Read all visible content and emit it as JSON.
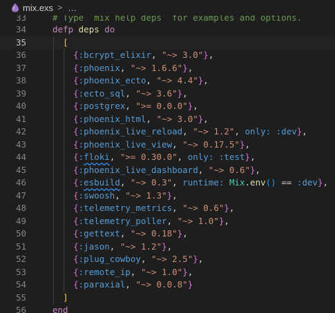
{
  "breadcrumb": {
    "file": "mix.exs",
    "separator": ">",
    "more": "…"
  },
  "editor": {
    "active_line": "35",
    "lines": [
      {
        "n": "33",
        "partial": true,
        "indent": 0,
        "tokens": [
          {
            "t": "# Type `mix help deps` for examples and options.",
            "c": "comment"
          }
        ]
      },
      {
        "n": "34",
        "indent": 0,
        "tokens": [
          {
            "t": "defp ",
            "c": "kw"
          },
          {
            "t": "deps",
            "c": "fn"
          },
          {
            "t": " do",
            "c": "kw"
          }
        ]
      },
      {
        "n": "35",
        "indent": 1,
        "tokens": [
          {
            "t": "[",
            "c": "bracket"
          }
        ]
      },
      {
        "n": "36",
        "indent": 2,
        "tokens": [
          {
            "t": "{",
            "c": "brace"
          },
          {
            "t": ":bcrypt_elixir",
            "c": "atom"
          },
          {
            "t": ", ",
            "c": "plain"
          },
          {
            "t": "\"~> 3.0\"",
            "c": "str"
          },
          {
            "t": "}",
            "c": "brace"
          },
          {
            "t": ",",
            "c": "plain"
          }
        ]
      },
      {
        "n": "37",
        "indent": 2,
        "tokens": [
          {
            "t": "{",
            "c": "brace"
          },
          {
            "t": ":phoenix",
            "c": "atom"
          },
          {
            "t": ", ",
            "c": "plain"
          },
          {
            "t": "\"~> 1.6.6\"",
            "c": "str"
          },
          {
            "t": "}",
            "c": "brace"
          },
          {
            "t": ",",
            "c": "plain"
          }
        ]
      },
      {
        "n": "38",
        "indent": 2,
        "tokens": [
          {
            "t": "{",
            "c": "brace"
          },
          {
            "t": ":phoenix_ecto",
            "c": "atom"
          },
          {
            "t": ", ",
            "c": "plain"
          },
          {
            "t": "\"~> 4.4\"",
            "c": "str"
          },
          {
            "t": "}",
            "c": "brace"
          },
          {
            "t": ",",
            "c": "plain"
          }
        ]
      },
      {
        "n": "39",
        "indent": 2,
        "tokens": [
          {
            "t": "{",
            "c": "brace"
          },
          {
            "t": ":ecto_sql",
            "c": "atom"
          },
          {
            "t": ", ",
            "c": "plain"
          },
          {
            "t": "\"~> 3.6\"",
            "c": "str"
          },
          {
            "t": "}",
            "c": "brace"
          },
          {
            "t": ",",
            "c": "plain"
          }
        ]
      },
      {
        "n": "40",
        "indent": 2,
        "tokens": [
          {
            "t": "{",
            "c": "brace"
          },
          {
            "t": ":postgrex",
            "c": "atom"
          },
          {
            "t": ", ",
            "c": "plain"
          },
          {
            "t": "\">= 0.0.0\"",
            "c": "str"
          },
          {
            "t": "}",
            "c": "brace"
          },
          {
            "t": ",",
            "c": "plain"
          }
        ]
      },
      {
        "n": "41",
        "indent": 2,
        "tokens": [
          {
            "t": "{",
            "c": "brace"
          },
          {
            "t": ":phoenix_html",
            "c": "atom"
          },
          {
            "t": ", ",
            "c": "plain"
          },
          {
            "t": "\"~> 3.0\"",
            "c": "str"
          },
          {
            "t": "}",
            "c": "brace"
          },
          {
            "t": ",",
            "c": "plain"
          }
        ]
      },
      {
        "n": "42",
        "indent": 2,
        "tokens": [
          {
            "t": "{",
            "c": "brace"
          },
          {
            "t": ":phoenix_live_reload",
            "c": "atom"
          },
          {
            "t": ", ",
            "c": "plain"
          },
          {
            "t": "\"~> 1.2\"",
            "c": "str"
          },
          {
            "t": ", ",
            "c": "plain"
          },
          {
            "t": "only: :dev",
            "c": "atom"
          },
          {
            "t": "}",
            "c": "brace"
          },
          {
            "t": ",",
            "c": "plain"
          }
        ]
      },
      {
        "n": "43",
        "indent": 2,
        "tokens": [
          {
            "t": "{",
            "c": "brace"
          },
          {
            "t": ":phoenix_live_view",
            "c": "atom"
          },
          {
            "t": ", ",
            "c": "plain"
          },
          {
            "t": "\"~> 0.17.5\"",
            "c": "str"
          },
          {
            "t": "}",
            "c": "brace"
          },
          {
            "t": ",",
            "c": "plain"
          }
        ]
      },
      {
        "n": "44",
        "indent": 2,
        "tokens": [
          {
            "t": "{",
            "c": "brace"
          },
          {
            "t": ":",
            "c": "atom"
          },
          {
            "t": "floki",
            "c": "atom",
            "sq": true
          },
          {
            "t": ", ",
            "c": "plain"
          },
          {
            "t": "\">= 0.30.0\"",
            "c": "str"
          },
          {
            "t": ", ",
            "c": "plain"
          },
          {
            "t": "only: :test",
            "c": "atom"
          },
          {
            "t": "}",
            "c": "brace"
          },
          {
            "t": ",",
            "c": "plain"
          }
        ]
      },
      {
        "n": "45",
        "indent": 2,
        "tokens": [
          {
            "t": "{",
            "c": "brace"
          },
          {
            "t": ":phoenix_live_dashboard",
            "c": "atom"
          },
          {
            "t": ", ",
            "c": "plain"
          },
          {
            "t": "\"~> 0.6\"",
            "c": "str"
          },
          {
            "t": "}",
            "c": "brace"
          },
          {
            "t": ",",
            "c": "plain"
          }
        ]
      },
      {
        "n": "46",
        "indent": 2,
        "tokens": [
          {
            "t": "{",
            "c": "brace"
          },
          {
            "t": ":",
            "c": "atom"
          },
          {
            "t": "esbuild",
            "c": "atom",
            "sq": true
          },
          {
            "t": ", ",
            "c": "plain"
          },
          {
            "t": "\"~> 0.3\"",
            "c": "str"
          },
          {
            "t": ", ",
            "c": "plain"
          },
          {
            "t": "runtime: ",
            "c": "atom"
          },
          {
            "t": "Mix",
            "c": "mod"
          },
          {
            "t": ".",
            "c": "plain"
          },
          {
            "t": "env",
            "c": "fn"
          },
          {
            "t": "()",
            "c": "paren"
          },
          {
            "t": " == ",
            "c": "plain"
          },
          {
            "t": ":dev",
            "c": "atom"
          },
          {
            "t": "}",
            "c": "brace"
          },
          {
            "t": ",",
            "c": "plain"
          }
        ]
      },
      {
        "n": "47",
        "indent": 2,
        "tokens": [
          {
            "t": "{",
            "c": "brace"
          },
          {
            "t": ":swoosh",
            "c": "atom"
          },
          {
            "t": ", ",
            "c": "plain"
          },
          {
            "t": "\"~> 1.3\"",
            "c": "str"
          },
          {
            "t": "}",
            "c": "brace"
          },
          {
            "t": ",",
            "c": "plain"
          }
        ]
      },
      {
        "n": "48",
        "indent": 2,
        "tokens": [
          {
            "t": "{",
            "c": "brace"
          },
          {
            "t": ":telemetry_metrics",
            "c": "atom"
          },
          {
            "t": ", ",
            "c": "plain"
          },
          {
            "t": "\"~> 0.6\"",
            "c": "str"
          },
          {
            "t": "}",
            "c": "brace"
          },
          {
            "t": ",",
            "c": "plain"
          }
        ]
      },
      {
        "n": "49",
        "indent": 2,
        "tokens": [
          {
            "t": "{",
            "c": "brace"
          },
          {
            "t": ":telemetry_poller",
            "c": "atom"
          },
          {
            "t": ", ",
            "c": "plain"
          },
          {
            "t": "\"~> 1.0\"",
            "c": "str"
          },
          {
            "t": "}",
            "c": "brace"
          },
          {
            "t": ",",
            "c": "plain"
          }
        ]
      },
      {
        "n": "50",
        "indent": 2,
        "tokens": [
          {
            "t": "{",
            "c": "brace"
          },
          {
            "t": ":gettext",
            "c": "atom"
          },
          {
            "t": ", ",
            "c": "plain"
          },
          {
            "t": "\"~> 0.18\"",
            "c": "str"
          },
          {
            "t": "}",
            "c": "brace"
          },
          {
            "t": ",",
            "c": "plain"
          }
        ]
      },
      {
        "n": "51",
        "indent": 2,
        "tokens": [
          {
            "t": "{",
            "c": "brace"
          },
          {
            "t": ":jason",
            "c": "atom"
          },
          {
            "t": ", ",
            "c": "plain"
          },
          {
            "t": "\"~> 1.2\"",
            "c": "str"
          },
          {
            "t": "}",
            "c": "brace"
          },
          {
            "t": ",",
            "c": "plain"
          }
        ]
      },
      {
        "n": "52",
        "indent": 2,
        "tokens": [
          {
            "t": "{",
            "c": "brace"
          },
          {
            "t": ":plug_cowboy",
            "c": "atom"
          },
          {
            "t": ", ",
            "c": "plain"
          },
          {
            "t": "\"~> 2.5\"",
            "c": "str"
          },
          {
            "t": "}",
            "c": "brace"
          },
          {
            "t": ",",
            "c": "plain"
          }
        ]
      },
      {
        "n": "53",
        "indent": 2,
        "tokens": [
          {
            "t": "{",
            "c": "brace"
          },
          {
            "t": ":remote_ip",
            "c": "atom"
          },
          {
            "t": ", ",
            "c": "plain"
          },
          {
            "t": "\"~> 1.0\"",
            "c": "str"
          },
          {
            "t": "}",
            "c": "brace"
          },
          {
            "t": ",",
            "c": "plain"
          }
        ]
      },
      {
        "n": "54",
        "indent": 2,
        "tokens": [
          {
            "t": "{",
            "c": "brace"
          },
          {
            "t": ":paraxial",
            "c": "atom"
          },
          {
            "t": ", ",
            "c": "plain"
          },
          {
            "t": "\"~> 0.0.8\"",
            "c": "str"
          },
          {
            "t": "}",
            "c": "brace"
          }
        ]
      },
      {
        "n": "55",
        "indent": 1,
        "tokens": [
          {
            "t": "]",
            "c": "bracket"
          }
        ]
      },
      {
        "n": "56",
        "indent": 0,
        "tokens": [
          {
            "t": "end",
            "c": "kw"
          }
        ]
      }
    ]
  },
  "colors": {
    "background": "#1e1e1e",
    "keyword": "#c586c0",
    "function": "#dcdcaa",
    "atom": "#569cd6",
    "string": "#ce9178",
    "brace": "#da70d6",
    "bracket": "#ffd700",
    "module": "#4ec9b0"
  },
  "icons": {
    "file": "elixir-drop-icon",
    "breadcrumb_separator": "chevron-right-icon"
  }
}
